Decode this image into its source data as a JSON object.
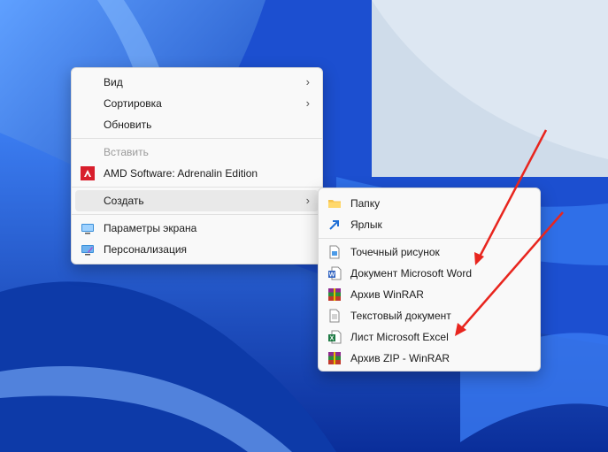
{
  "context_menu": {
    "items": [
      {
        "label": "Вид"
      },
      {
        "label": "Сортировка"
      },
      {
        "label": "Обновить"
      },
      {
        "label": "Вставить"
      },
      {
        "label": "AMD Software: Adrenalin Edition"
      },
      {
        "label": "Создать"
      },
      {
        "label": "Параметры экрана"
      },
      {
        "label": "Персонализация"
      }
    ]
  },
  "create_submenu": {
    "items": [
      {
        "label": "Папку"
      },
      {
        "label": "Ярлык"
      },
      {
        "label": "Точечный рисунок"
      },
      {
        "label": "Документ Microsoft Word"
      },
      {
        "label": "Архив WinRAR"
      },
      {
        "label": "Текстовый документ"
      },
      {
        "label": "Лист Microsoft Excel"
      },
      {
        "label": "Архив ZIP - WinRAR"
      }
    ]
  },
  "colors": {
    "annotation_arrow": "#e8251e",
    "wallpaper_base": "#1a56d6"
  }
}
